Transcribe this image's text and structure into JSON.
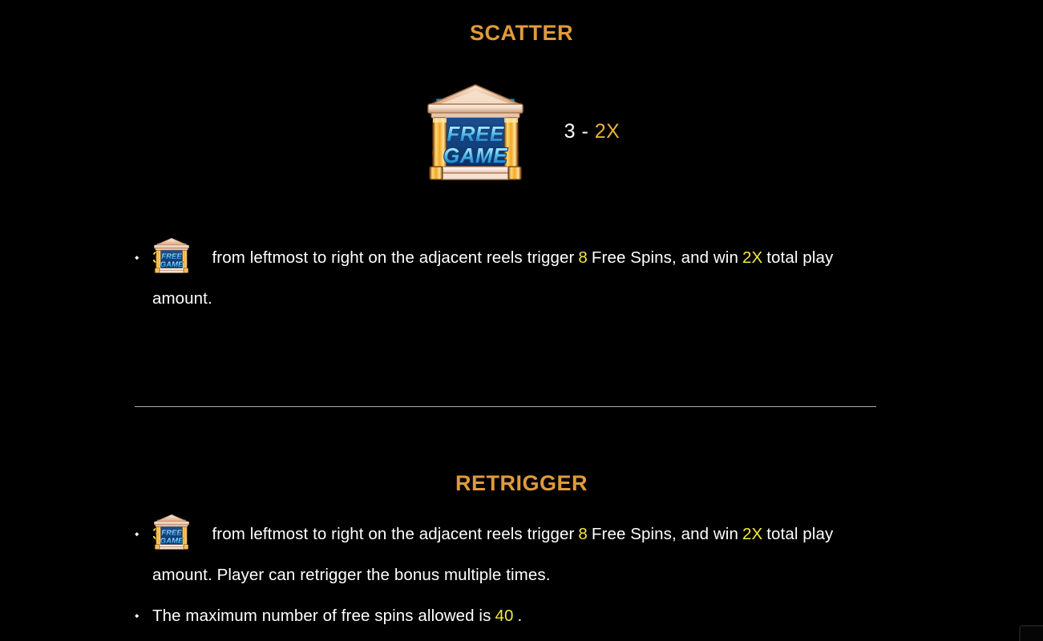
{
  "background_color": "#000000",
  "accent_heading_color": "#e09a3c",
  "highlight_yellow": "#f2e940",
  "multiplier_gold": "#e8b33a",
  "body_text_color": "#ffffff",
  "divider_color": "#cfc9c2",
  "scatter": {
    "title": "SCATTER",
    "symbol_name": "free-game-scatter-symbol",
    "symbol_label_line1": "FREE",
    "symbol_label_line2": "GAME",
    "paytable": {
      "count": "3",
      "separator": "-",
      "award": "2X"
    },
    "bullets": [
      {
        "marker": "⬩",
        "count": "3",
        "text_after_symbol": "from leftmost to right on the adjacent reels trigger",
        "spins": "8",
        "text_mid": "Free Spins, and win",
        "multiplier": "2X",
        "text_end": "total play amount."
      }
    ]
  },
  "retrigger": {
    "title": "RETRIGGER",
    "bullets": [
      {
        "marker": "⬩",
        "count": "3",
        "text_after_symbol": "from leftmost to right on the adjacent reels trigger",
        "spins": "8",
        "text_mid": "Free Spins, and win",
        "multiplier": "2X",
        "text_end": "total play amount. Player can retrigger the bonus multiple times."
      },
      {
        "marker": "⬩",
        "text_before": "The maximum number of free spins allowed is",
        "max_spins": "40",
        "text_end": "."
      }
    ]
  }
}
